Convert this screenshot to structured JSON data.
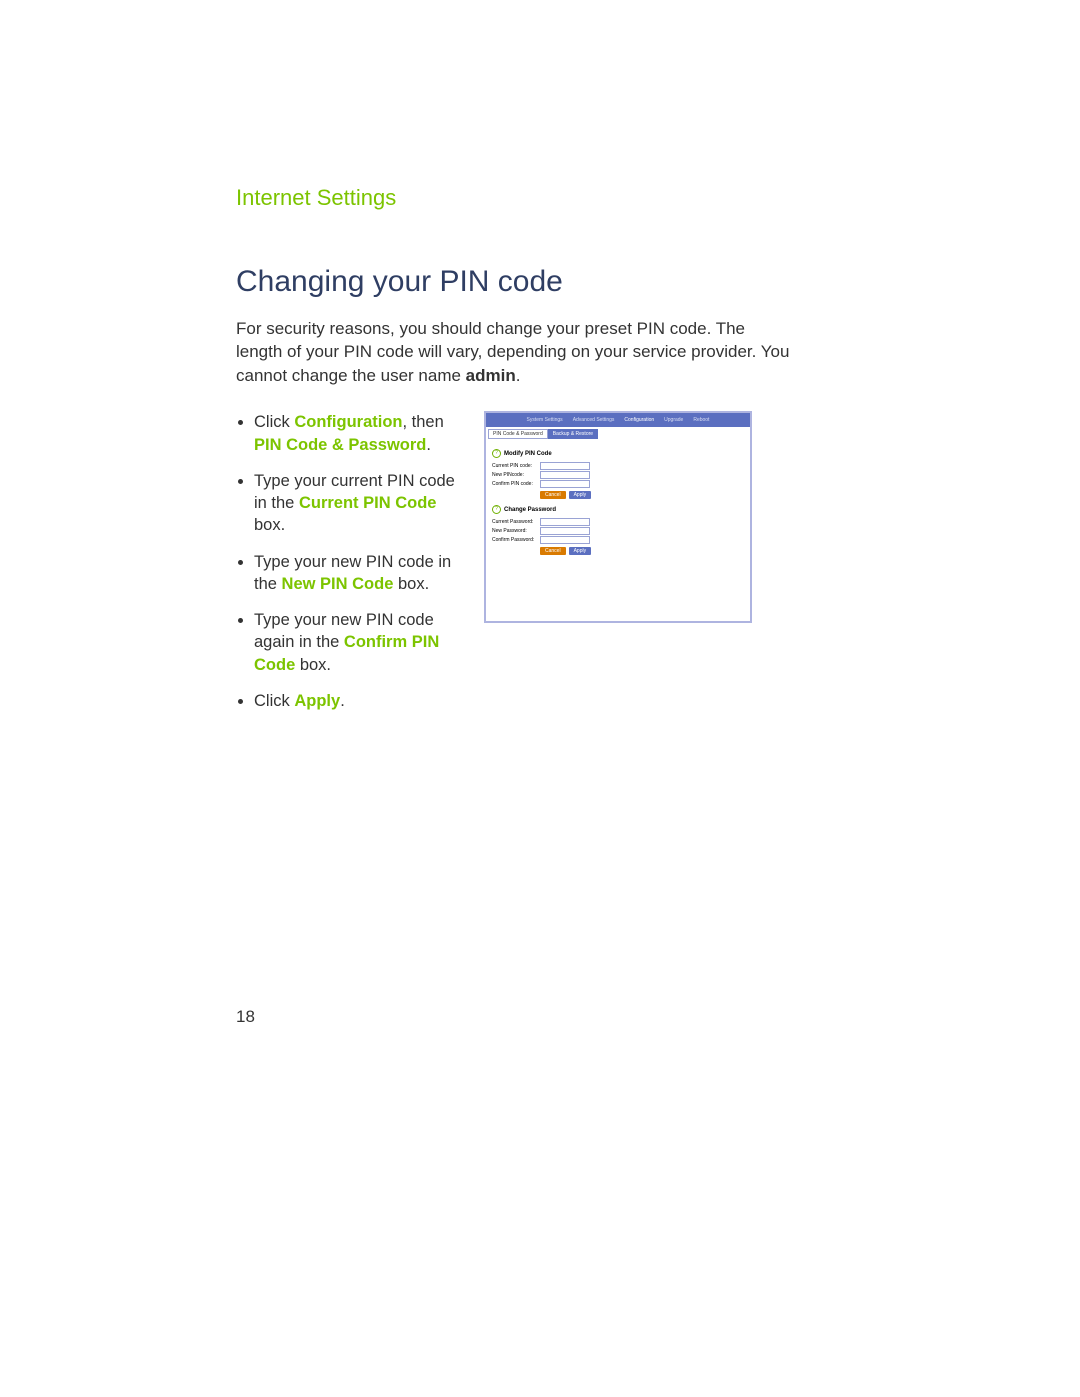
{
  "page": {
    "section_header": "Internet Settings",
    "title": "Changing your PIN code",
    "intro_part1": "For security reasons, you should change your preset PIN code. The length of your PIN code will vary, depending on your service provider. You cannot change the user name ",
    "intro_bold": "admin",
    "intro_part2": ".",
    "page_number": "18"
  },
  "steps": {
    "s1_a": "Click ",
    "s1_hl1": "Configuration",
    "s1_b": ", then ",
    "s1_hl2": "PIN Code & Password",
    "s1_c": ".",
    "s2_a": "Type your current PIN code in the ",
    "s2_hl": "Current PIN Code",
    "s2_b": " box.",
    "s3_a": "Type your new PIN code in the ",
    "s3_hl": "New PIN Code",
    "s3_b": " box.",
    "s4_a": "Type your new PIN code again in the ",
    "s4_hl": "Confirm PIN Code",
    "s4_b": " box.",
    "s5_a": "Click ",
    "s5_hl": "Apply",
    "s5_b": "."
  },
  "panel": {
    "nav": {
      "system": "System Settings",
      "advanced": "Advanced Settings",
      "configuration": "Configuration",
      "upgrade": "Upgrade",
      "reboot": "Reboot"
    },
    "tabs": {
      "pin": "PIN Code & Password",
      "backup": "Backup & Restore"
    },
    "section1_title": "Modify PIN Code",
    "section2_title": "Change Password",
    "fields": {
      "current_pin": "Current PIN code:",
      "new_pin": "New PINcode:",
      "confirm_pin": "Confirm PIN code:",
      "current_pw": "Current Password:",
      "new_pw": "New Password:",
      "confirm_pw": "Confirm Password:"
    },
    "buttons": {
      "cancel": "Cancel",
      "apply": "Apply"
    },
    "q_mark": "?"
  }
}
